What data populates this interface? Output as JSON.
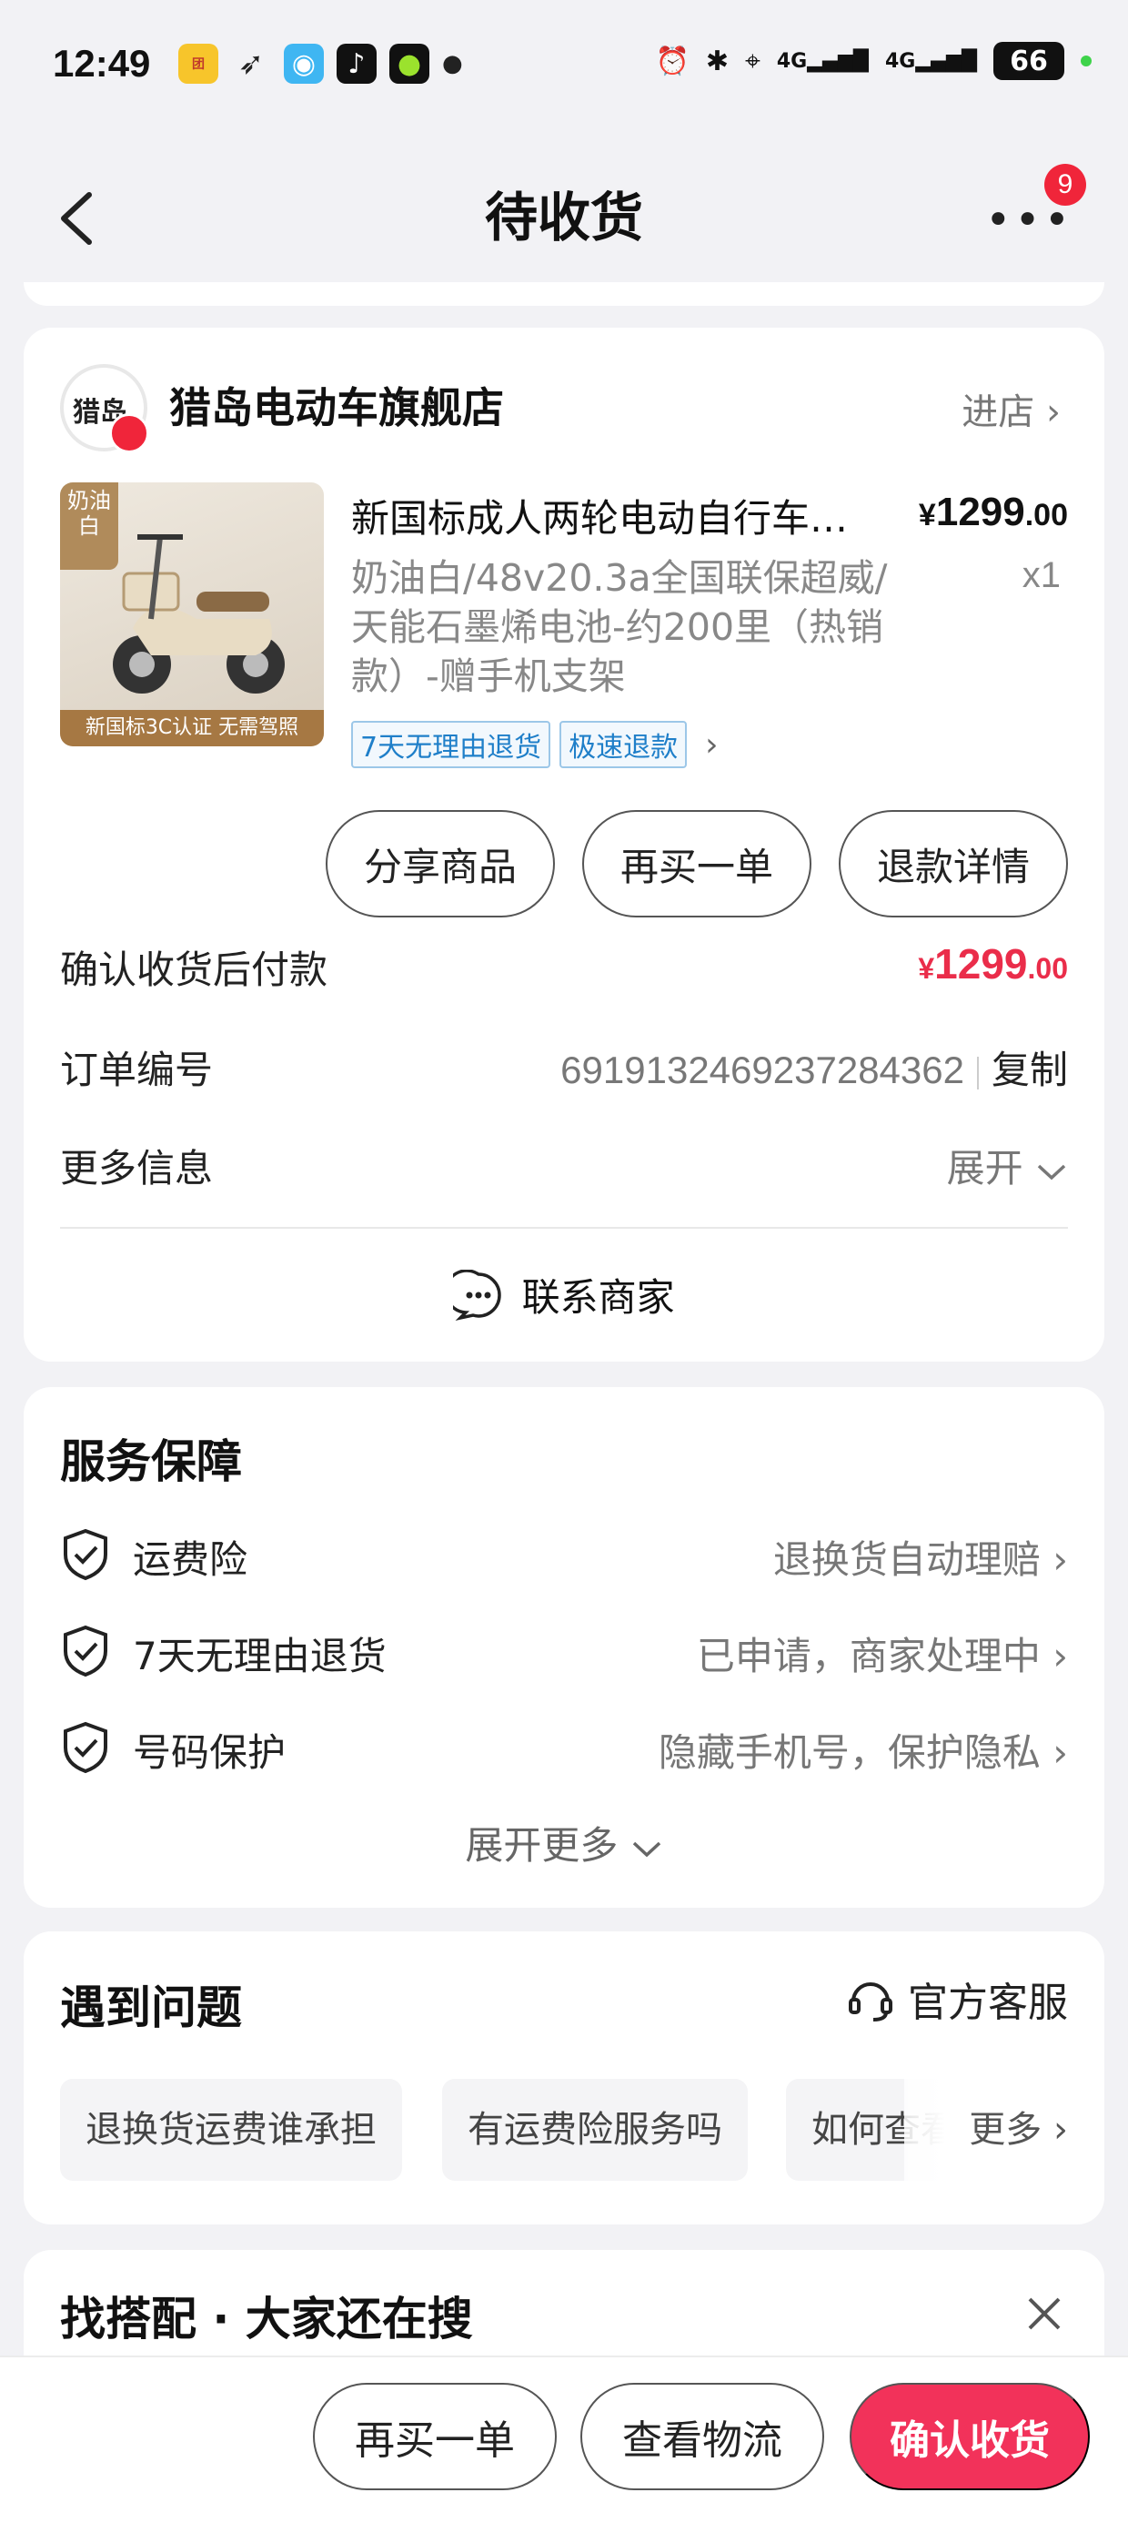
{
  "status_bar": {
    "time": "12:49",
    "apps": [
      {
        "name": "meituan-app-icon",
        "color": "#f7c52b",
        "text": "团购"
      },
      {
        "name": "bird-app-icon",
        "color": "#ffffff",
        "text": "➶"
      },
      {
        "name": "blue-app-icon",
        "color": "#3fb6f2",
        "text": "◉"
      },
      {
        "name": "tiktok-app-icon",
        "color": "#111111",
        "text": "♪"
      },
      {
        "name": "green-app-icon",
        "color": "#111111",
        "text": "●"
      }
    ],
    "network_4g_1": "4G",
    "network_4g_2": "4G",
    "battery": "66"
  },
  "navbar": {
    "title": "待收货",
    "more_badge": "9"
  },
  "order_card": {
    "shop_name": "猎岛电动车旗舰店",
    "shop_logo_text": "猎岛",
    "enter_shop": "进店 ›",
    "product": {
      "image_tag": "奶油白",
      "image_banner": "新国标3C认证 无需驾照",
      "title": "新国标成人两轮电动自行车电瓶车",
      "price_symbol": "¥",
      "price_int": "1299",
      "price_dec": ".00",
      "spec": "奶油白/48v20.3a全国联保超威/天能石墨烯电池-约200里（热销款）-赠手机支架",
      "qty": "x1",
      "tags": [
        "7天无理由退货",
        "极速退款"
      ]
    },
    "buttons": {
      "share": "分享商品",
      "rebuy": "再买一单",
      "refund": "退款详情"
    },
    "pay_after": {
      "label": "确认收货后付款",
      "price_symbol": "¥",
      "price_int": "1299",
      "price_dec": ".00"
    },
    "order_no": {
      "label": "订单编号",
      "value": "6919132469237284362",
      "copy": "复制"
    },
    "more_info": {
      "label": "更多信息",
      "action": "展开"
    },
    "contact": "联系商家"
  },
  "service": {
    "title": "服务保障",
    "items": [
      {
        "label": "运费险",
        "value": "退换货自动理赔"
      },
      {
        "label": "7天无理由退货",
        "value": "已申请，商家处理中"
      },
      {
        "label": "号码保护",
        "value": "隐藏手机号，保护隐私"
      }
    ],
    "expand": "展开更多"
  },
  "problems": {
    "title": "遇到问题",
    "customer_service": "官方客服",
    "chips": [
      "退换货运费谁承担",
      "有运费险服务吗",
      "如何查看物流"
    ],
    "more": "更多"
  },
  "recommend": {
    "title": "找搭配 · 大家还在搜"
  },
  "bottom_bar": {
    "rebuy": "再买一单",
    "logistics": "查看物流",
    "confirm": "确认收货"
  },
  "colors": {
    "accent_red": "#ea2d4a",
    "primary_button": "#f2325a",
    "tag_blue": "#1f7fc9"
  }
}
